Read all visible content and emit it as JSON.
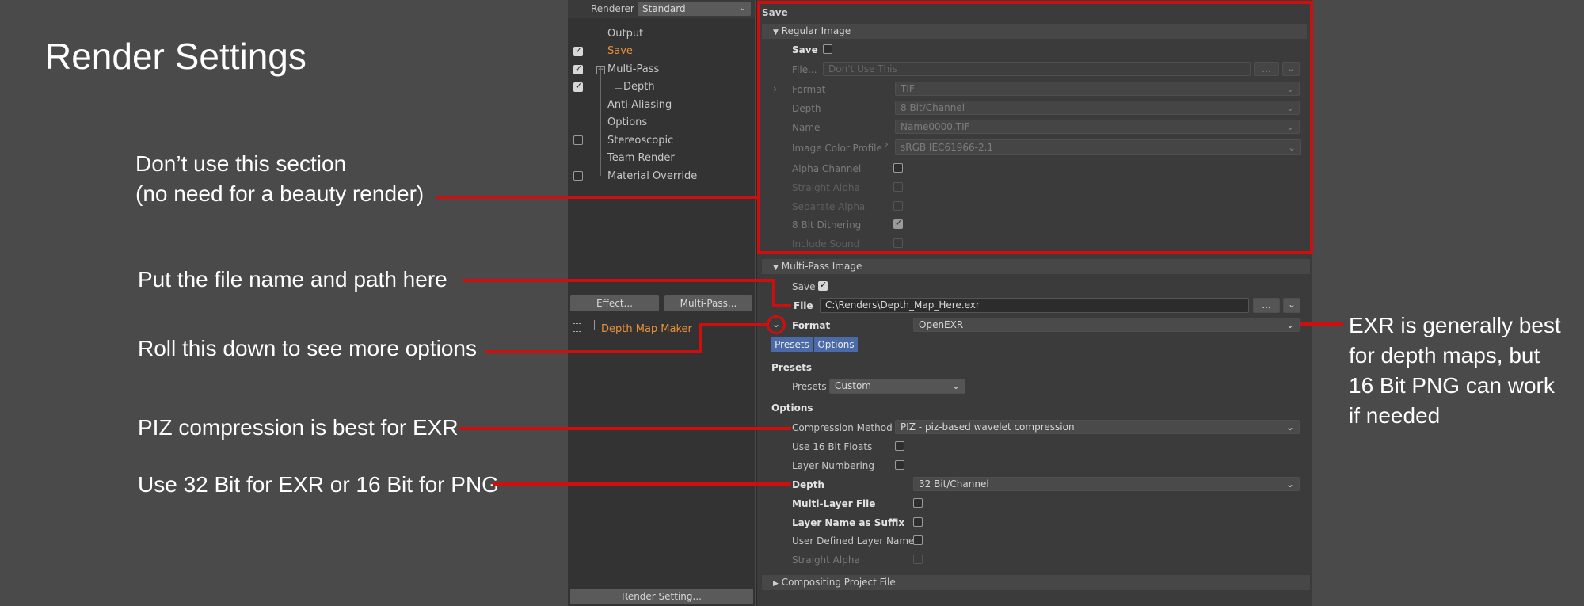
{
  "slide": {
    "title": "Render Settings",
    "notes": {
      "dont_use_line1": "Don’t use this section",
      "dont_use_line2": "(no need for a beauty render)",
      "file_path": "Put the file name and path here",
      "roll_down": "Roll this down to see more options",
      "piz": "PIZ compression is best for EXR",
      "bit_depth": "Use 32 Bit for EXR or 16 Bit for PNG",
      "exr_line1": "EXR is generally best",
      "exr_line2": "for depth maps, but",
      "exr_line3": "16 Bit PNG can work",
      "exr_line4": "if needed"
    },
    "highlight_color": "#d10e0e"
  },
  "left_panel": {
    "renderer_label": "Renderer",
    "renderer_value": "Standard",
    "tree": [
      {
        "label": "Output",
        "checked": null
      },
      {
        "label": "Save",
        "checked": true,
        "active": true
      },
      {
        "label": "Multi-Pass",
        "checked": true
      },
      {
        "label": "Depth",
        "checked": true
      },
      {
        "label": "Anti-Aliasing",
        "checked": null
      },
      {
        "label": "Options",
        "checked": null
      },
      {
        "label": "Stereoscopic",
        "checked": false
      },
      {
        "label": "Team Render",
        "checked": null
      },
      {
        "label": "Material Override",
        "checked": false
      }
    ],
    "effect_button": "Effect...",
    "multipass_button": "Multi-Pass...",
    "depth_map_maker": "Depth Map Maker",
    "render_setting_button": "Render Setting..."
  },
  "save_panel": {
    "header": "Save",
    "regular_image": {
      "section": "Regular Image",
      "save_label": "Save",
      "file_label": "File...",
      "file_placeholder": "Don't Use This",
      "file_btn": "...",
      "format_label": "Format",
      "format_value": "TIF",
      "depth_label": "Depth",
      "depth_value": "8 Bit/Channel",
      "name_label": "Name",
      "name_value": "Name0000.TIF",
      "color_profile_label": "Image Color Profile",
      "color_profile_value": "sRGB IEC61966-2.1",
      "alpha_channel": "Alpha Channel",
      "straight_alpha": "Straight Alpha",
      "separate_alpha": "Separate Alpha",
      "dithering": "8 Bit Dithering",
      "include_sound": "Include Sound"
    },
    "multi_pass": {
      "section": "Multi-Pass Image",
      "save_label": "Save",
      "file_label": "File",
      "file_value": "C:\\Renders\\Depth_Map_Here.exr",
      "file_btn": "...",
      "format_label": "Format",
      "format_value": "OpenEXR",
      "presets_tab": "Presets",
      "options_tab": "Options",
      "presets_heading": "Presets",
      "presets_label": "Presets",
      "presets_value": "Custom",
      "options_heading": "Options",
      "compression_label": "Compression Method",
      "compression_value": "PIZ - piz-based wavelet compression",
      "floats_label": "Use 16 Bit Floats",
      "layer_numbering": "Layer Numbering",
      "depth_label": "Depth",
      "depth_value": "32 Bit/Channel",
      "multi_layer": "Multi-Layer File",
      "layer_suffix": "Layer Name as Suffix",
      "user_layer": "User Defined Layer Name",
      "straight_alpha": "Straight Alpha"
    },
    "compositing": "Compositing Project File"
  }
}
